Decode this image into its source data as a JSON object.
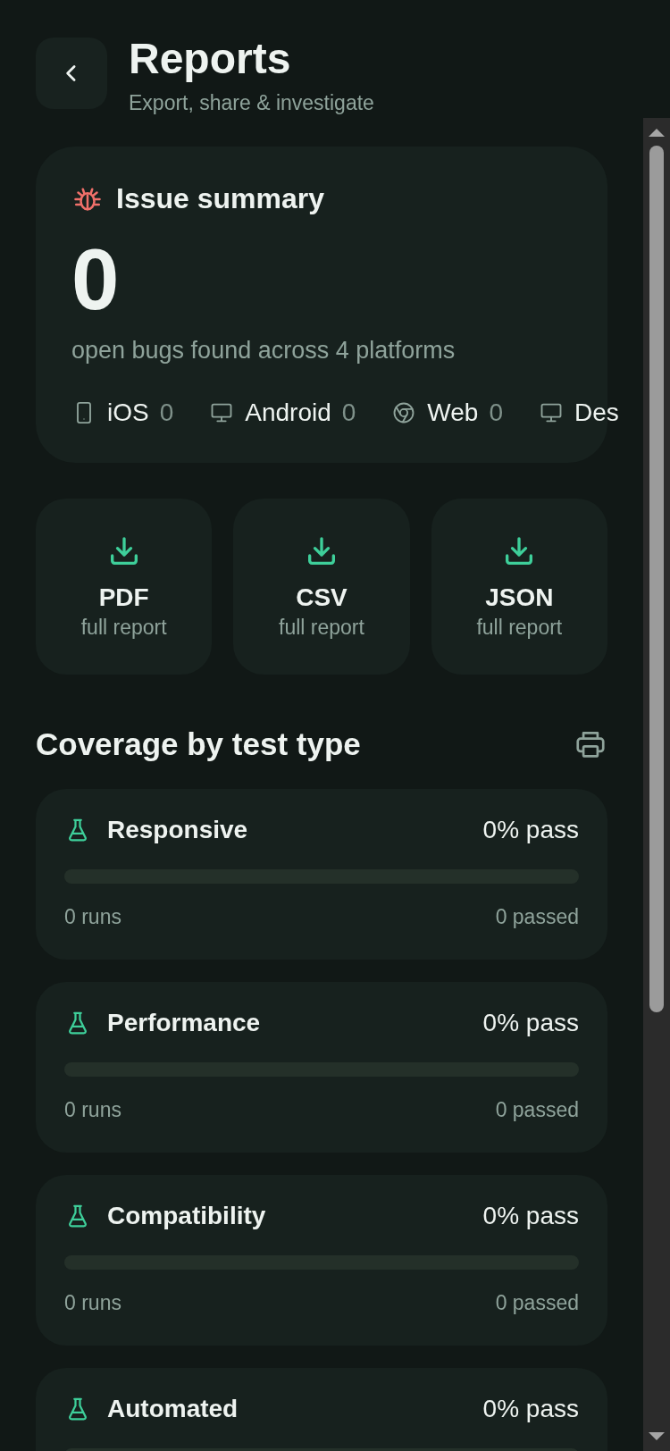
{
  "header": {
    "title": "Reports",
    "subtitle": "Export, share & investigate"
  },
  "summary": {
    "title": "Issue summary",
    "count": "0",
    "caption": "open bugs found across 4 platforms",
    "platforms": [
      {
        "kind": "mobile",
        "name": "iOS",
        "count": "0"
      },
      {
        "kind": "desktop",
        "name": "Android",
        "count": "0"
      },
      {
        "kind": "web",
        "name": "Web",
        "count": "0"
      },
      {
        "kind": "desktop",
        "name": "Des"
      }
    ]
  },
  "exports": [
    {
      "format": "PDF",
      "caption": "full report"
    },
    {
      "format": "CSV",
      "caption": "full report"
    },
    {
      "format": "JSON",
      "caption": "full report"
    }
  ],
  "coverage": {
    "title": "Coverage by test type",
    "items": [
      {
        "name": "Responsive",
        "pass": "0% pass",
        "level": 0,
        "runs": "0 runs",
        "passed": "0 passed"
      },
      {
        "name": "Performance",
        "pass": "0% pass",
        "level": 0,
        "runs": "0 runs",
        "passed": "0 passed"
      },
      {
        "name": "Compatibility",
        "pass": "0% pass",
        "level": 0,
        "runs": "0 runs",
        "passed": "0 passed"
      },
      {
        "name": "Automated",
        "pass": "0% pass",
        "level": 0
      }
    ]
  }
}
